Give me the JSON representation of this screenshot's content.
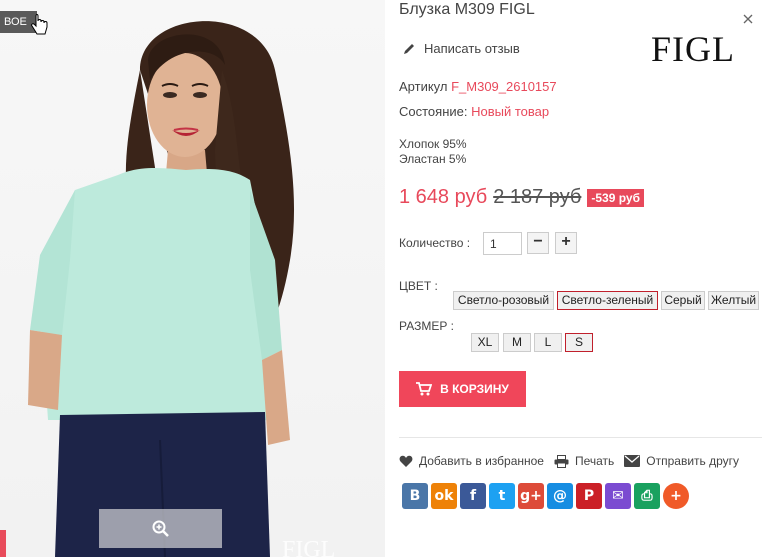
{
  "badge": {
    "label": "ВОЕ"
  },
  "product": {
    "title": "Блузка M309 FIGL",
    "brand": "FIGL",
    "write_review": "Написать отзыв",
    "sku_label": "Артикул",
    "sku": "F_M309_2610157",
    "condition_label": "Состояние:",
    "condition": "Новый товар",
    "composition": [
      "Хлопок 95%",
      "Эластан 5%"
    ]
  },
  "price": {
    "current": "1 648 руб",
    "old": "2 187 руб",
    "discount": "-539 руб"
  },
  "quantity": {
    "label": "Количество :",
    "value": "1",
    "minus": "−",
    "plus": "+"
  },
  "color": {
    "label": "ЦВЕТ :",
    "options": [
      "Светло-розовый",
      "Светло-зеленый",
      "Серый",
      "Желтый"
    ],
    "selected": "Светло-зеленый"
  },
  "size": {
    "label": "РАЗМЕР :",
    "options": [
      "XL",
      "M",
      "L",
      "S"
    ],
    "selected": "S"
  },
  "cart": {
    "label": "В КОРЗИНУ"
  },
  "actions": {
    "wishlist": "Добавить в избранное",
    "print": "Печать",
    "send": "Отправить другу"
  },
  "social": [
    {
      "icon": "vk-icon",
      "glyph": "B",
      "color": "#4a76a8"
    },
    {
      "icon": "odnoklassniki-icon",
      "glyph": "ok",
      "color": "#ee8208"
    },
    {
      "icon": "facebook-icon",
      "glyph": "f",
      "color": "#3b5998"
    },
    {
      "icon": "twitter-icon",
      "glyph": "t",
      "color": "#1da1f2"
    },
    {
      "icon": "google-plus-icon",
      "glyph": "g+",
      "color": "#dd4b39"
    },
    {
      "icon": "mail-ru-icon",
      "glyph": "@",
      "color": "#168de2"
    },
    {
      "icon": "pinterest-icon",
      "glyph": "P",
      "color": "#cb2027"
    },
    {
      "icon": "email-icon",
      "glyph": "✉",
      "color": "#7b4bd1"
    },
    {
      "icon": "print-icon",
      "glyph": "⎙",
      "color": "#19a15f"
    },
    {
      "icon": "more-share-icon",
      "glyph": "+",
      "color": "#f05a28"
    }
  ],
  "photo": {
    "watermark": "FIGL"
  },
  "colors": {
    "accent": "#e8495b",
    "button": "#f0465a"
  }
}
